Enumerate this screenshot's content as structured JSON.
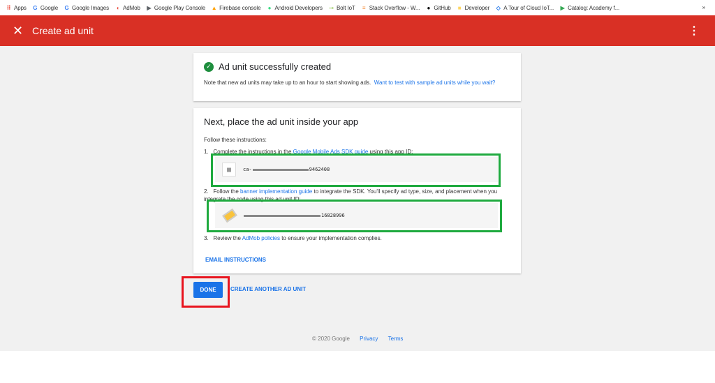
{
  "bookmarks": [
    {
      "label": "Apps",
      "icon": "apps-grid-icon",
      "color": "#ea4335"
    },
    {
      "label": "Google",
      "icon": "google-icon",
      "color": "#4285f4"
    },
    {
      "label": "Google Images",
      "icon": "google-icon",
      "color": "#4285f4"
    },
    {
      "label": "AdMob",
      "icon": "admob-icon",
      "color": "#ea4335"
    },
    {
      "label": "Google Play Console",
      "icon": "play-console-icon",
      "color": "#5f6368"
    },
    {
      "label": "Firebase console",
      "icon": "firebase-icon",
      "color": "#ffa000"
    },
    {
      "label": "Android Developers",
      "icon": "android-icon",
      "color": "#3ddc84"
    },
    {
      "label": "Bolt IoT",
      "icon": "bolt-icon",
      "color": "#9ccc65"
    },
    {
      "label": "Stack Overflow - W...",
      "icon": "stackoverflow-icon",
      "color": "#f48024"
    },
    {
      "label": "GitHub",
      "icon": "github-icon",
      "color": "#000000"
    },
    {
      "label": "Developer",
      "icon": "folder-icon",
      "color": "#fdd663"
    },
    {
      "label": "A Tour of Cloud IoT...",
      "icon": "cloud-iot-icon",
      "color": "#1a73e8"
    },
    {
      "label": "Catalog: Academy f...",
      "icon": "play-icon",
      "color": "#34a853"
    }
  ],
  "more": "»",
  "header": {
    "close": "✕",
    "title": "Create ad unit",
    "menu": "⋮"
  },
  "success": {
    "title": "Ad unit successfully created",
    "note": "Note that new ad units may take up to an hour to start showing ads.",
    "link": "Want to test with sample ad units while you wait?"
  },
  "next": {
    "title": "Next, place the ad unit inside your app",
    "intro": "Follow these instructions:",
    "step1": {
      "num": "1.",
      "pre": "Complete the instructions in the",
      "link": "Google Mobile Ads SDK guide",
      "post": "using this app ID:",
      "id_prefix": "ca-",
      "id_suffix": "9462408"
    },
    "step2": {
      "num": "2.",
      "pre": "Follow the",
      "link": "banner implementation guide",
      "post": "to integrate the SDK. You'll specify ad type, size, and placement when you integrate the code using this ad unit ID:",
      "id_suffix": "16828996"
    },
    "step3": {
      "num": "3.",
      "pre": "Review the",
      "link": "AdMob policies",
      "post": "to ensure your implementation complies."
    },
    "email": "EMAIL INSTRUCTIONS"
  },
  "actions": {
    "done": "DONE",
    "another": "CREATE ANOTHER AD UNIT"
  },
  "footer": {
    "copyright": "© 2020 Google",
    "privacy": "Privacy",
    "terms": "Terms"
  }
}
